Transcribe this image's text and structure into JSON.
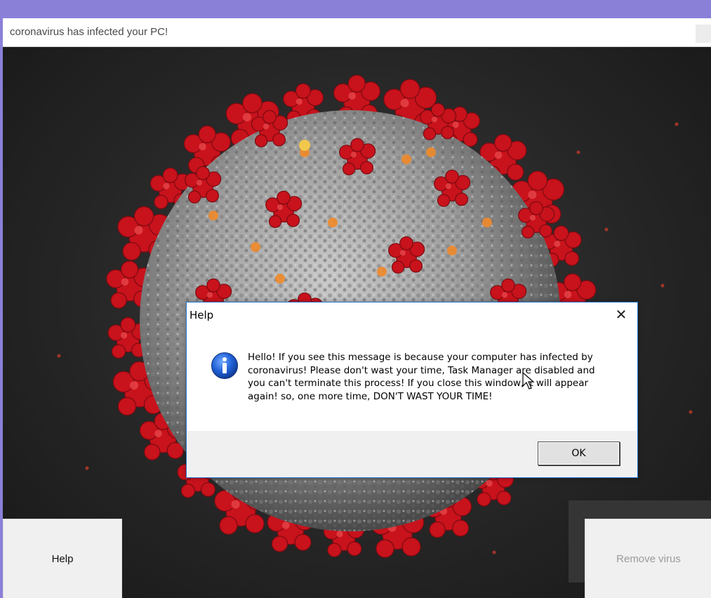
{
  "window": {
    "title": "coronavirus has infected your PC!"
  },
  "buttons": {
    "help_label": "Help",
    "remove_label": "Remove virus"
  },
  "dialog": {
    "title": "Help",
    "close_glyph": "✕",
    "message": "Hello! If you see this message is because your computer has infected by coronavirus! Please don't wast your time, Task Manager are disabled and you can't terminate this process! If you close this window, it will appear again! so, one more time, DON'T WAST YOUR TIME!",
    "ok_label": "OK",
    "icon": "info-icon"
  },
  "colors": {
    "accent": "#2b79d6",
    "virus_red": "#c8121c",
    "virus_grey": "#9a9a9a",
    "background_dark": "#262626"
  }
}
